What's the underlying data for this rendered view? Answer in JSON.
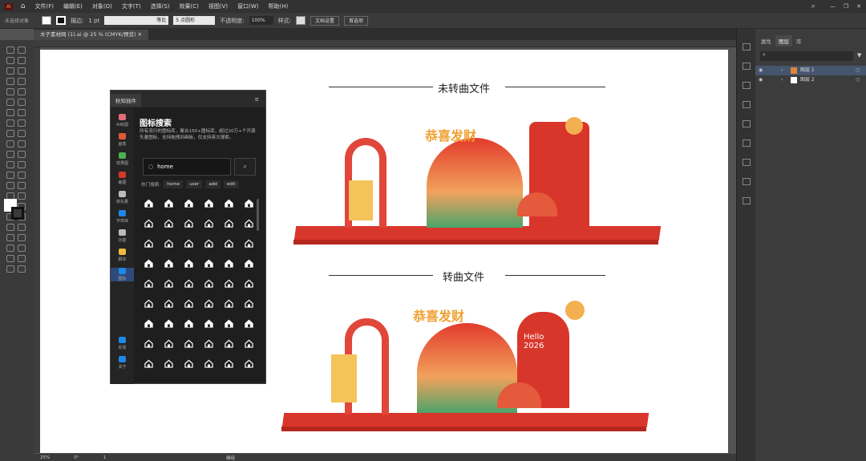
{
  "app": {
    "logo": "Ai"
  },
  "menu": [
    "文件(F)",
    "编辑(E)",
    "对象(O)",
    "文字(T)",
    "选择(S)",
    "效果(C)",
    "视图(V)",
    "窗口(W)",
    "帮助(H)"
  ],
  "control": {
    "selection": "未选择对象",
    "stroke_label": "描边:",
    "stroke_value": "1 pt",
    "stroke_style": "等比",
    "brush": "5 点圆形",
    "opacity_label": "不透明度:",
    "opacity": "100%",
    "style_label": "样式:",
    "doc_setup": "文档设置",
    "preferences": "首选项"
  },
  "document_tab": "木子素材网 (1).ai @ 25 % (CMYK/预览)",
  "artboard": {
    "title_top": "未转曲文件",
    "title_bottom": "转曲文件",
    "sign_text": "Hello 2026",
    "banner_text": "恭喜发财"
  },
  "plugin": {
    "tab": "秋知插件",
    "title": "图标搜索",
    "description": "所有流行的图标库，聚合150+图标库，超过20万+个开源矢量图标，支持拖拽到画板，仅支持英文搜索。",
    "search_value": "home",
    "hot_label": "热门搜索:",
    "hot_tags": [
      "home",
      "user",
      "add",
      "edit"
    ],
    "sidebar": [
      {
        "label": "AI绘图",
        "color": "#e56b7b"
      },
      {
        "label": "画笔",
        "color": "#e2593a"
      },
      {
        "label": "效果图",
        "color": "#4caf50"
      },
      {
        "label": "裁图",
        "color": "#d9362b"
      },
      {
        "label": "转矢量",
        "color": "#bbbbbb"
      },
      {
        "label": "字体库",
        "color": "#1e88e5"
      },
      {
        "label": "功能",
        "color": "#bbbbbb"
      },
      {
        "label": "脚本",
        "color": "#f0b840"
      },
      {
        "label": "图标",
        "color": "#1e88e5"
      }
    ],
    "sidebar_bottom": [
      {
        "label": "反馈",
        "color": "#1e88e5"
      },
      {
        "label": "关于",
        "color": "#1e88e5"
      }
    ],
    "icon_grid": {
      "rows": 9,
      "cols": 6
    }
  },
  "layers_panel": {
    "tabs": [
      "属性",
      "图层",
      "库"
    ],
    "layers": [
      {
        "name": "图层 1"
      },
      {
        "name": "图层 2"
      }
    ]
  },
  "status": {
    "zoom": "25%",
    "angle": "0°",
    "page": "1",
    "mode": "编组"
  }
}
